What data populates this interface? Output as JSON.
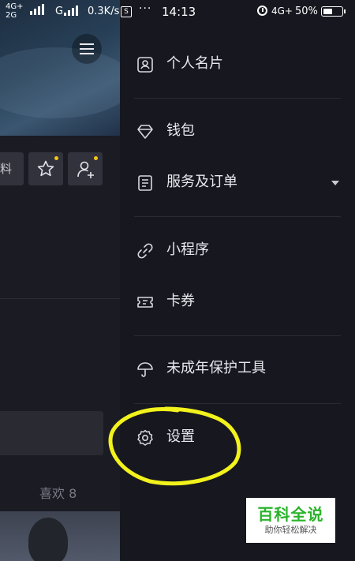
{
  "status_bar": {
    "network_top": "4G+",
    "network_bottom": "2G",
    "carrier_g": "G",
    "speed": "0.3K/s",
    "s_badge": "S",
    "dots": "···",
    "time": "14:13",
    "network_right": "4G+",
    "battery": "50%",
    "battery_level": 0.5
  },
  "background_page": {
    "profile_button_fragment": "料",
    "likes_label": "喜欢 8",
    "dot_color": "#f5c518"
  },
  "drawer": {
    "items": [
      {
        "label": "个人名片",
        "icon": "id-card-icon"
      },
      {
        "label": "钱包",
        "icon": "diamond-icon"
      },
      {
        "label": "服务及订单",
        "icon": "document-icon"
      },
      {
        "label": "小程序",
        "icon": "link-icon"
      },
      {
        "label": "卡券",
        "icon": "ticket-icon"
      },
      {
        "label": "未成年保护工具",
        "icon": "umbrella-icon"
      },
      {
        "label": "设置",
        "icon": "gear-icon"
      }
    ]
  },
  "annotation_color": "#f2f21c",
  "watermark": {
    "main": "百科全说",
    "sub": "助你轻松解决"
  }
}
